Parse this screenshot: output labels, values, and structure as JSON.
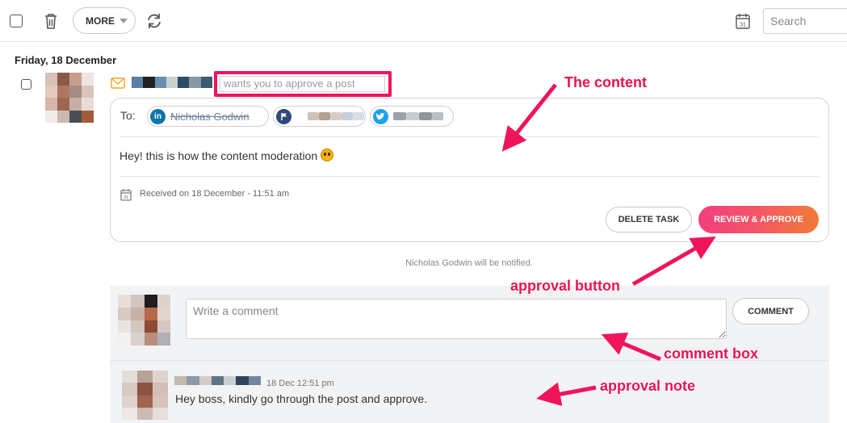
{
  "toolbar": {
    "more_label": "MORE",
    "search_placeholder": "Search",
    "calendar_day": "31"
  },
  "task": {
    "date_heading": "Friday, 18 December",
    "action_text": "wants you to approve a post",
    "to_label": "To:",
    "recipients": [
      {
        "network": "LinkedIn",
        "icon": "linkedin-icon",
        "name": "Nicholas Godwin",
        "color": "#0e76a8"
      },
      {
        "network": "Page",
        "icon": "flag-icon",
        "name": "",
        "color": "#3b5998"
      },
      {
        "network": "Twitter",
        "icon": "twitter-icon",
        "name": "",
        "color": "#1da1f2"
      }
    ],
    "content": "Hey! this is how the content moderation",
    "received": "Received on 18 December - 11:51 am",
    "delete_label": "DELETE TASK",
    "review_label": "REVIEW & APPROVE",
    "notify_text": "Nicholas Godwin will be notified."
  },
  "comments": {
    "placeholder": "Write a comment",
    "comment_button": "COMMENT",
    "note": {
      "time": "18 Dec 12:51 pm",
      "text": "Hey boss, kindly go through the post and approve."
    }
  },
  "annotations": {
    "content": "The content",
    "approval_button": "approval button",
    "comment_box": "comment box",
    "approval_note": "approval note"
  },
  "colors": {
    "accent_pink": "#f0145a",
    "review_gradient_start": "#f23f7c",
    "review_gradient_end": "#f37b36"
  }
}
